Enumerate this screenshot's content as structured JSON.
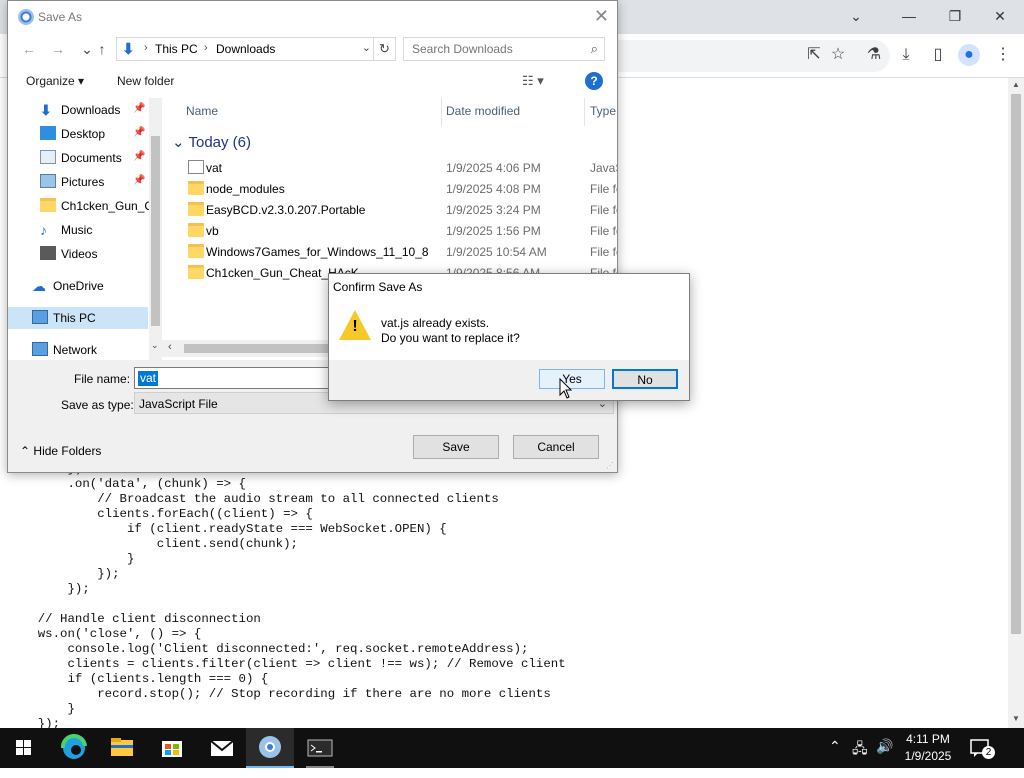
{
  "save_dialog": {
    "title": "Save As",
    "address": {
      "crumb1": "This PC",
      "crumb2": "Downloads"
    },
    "search_placeholder": "Search Downloads",
    "toolbar": {
      "organize": "Organize ▾",
      "new_folder": "New folder"
    },
    "nav": {
      "downloads": "Downloads",
      "desktop": "Desktop",
      "documents": "Documents",
      "pictures": "Pictures",
      "chicken": "Ch1cken_Gun_C",
      "music": "Music",
      "videos": "Videos",
      "onedrive": "OneDrive",
      "thispc": "This PC",
      "network": "Network"
    },
    "columns": {
      "name": "Name",
      "date": "Date modified",
      "type": "Type"
    },
    "group_label": "Today (6)",
    "files": {
      "f0": {
        "name": "vat",
        "date": "1/9/2025 4:06 PM",
        "type": "JavaS"
      },
      "f1": {
        "name": "node_modules",
        "date": "1/9/2025 4:08 PM",
        "type": "File fo"
      },
      "f2": {
        "name": "EasyBCD.v2.3.0.207.Portable",
        "date": "1/9/2025 3:24 PM",
        "type": "File fo"
      },
      "f3": {
        "name": "vb",
        "date": "1/9/2025 1:56 PM",
        "type": "File fo"
      },
      "f4": {
        "name": "Windows7Games_for_Windows_11_10_8",
        "date": "1/9/2025 10:54 AM",
        "type": "File fo"
      },
      "f5": {
        "name": "Ch1cken_Gun_Cheat_HAcK",
        "date": "1/9/2025 8:56 AM",
        "type": "File fo"
      }
    },
    "file_name_label": "File name:",
    "file_name_value": "vat",
    "save_type_label": "Save as type:",
    "save_type_value": "JavaScript File",
    "hide_folders": "Hide Folders",
    "save_button": "Save",
    "cancel_button": "Cancel"
  },
  "confirm_dialog": {
    "title": "Confirm Save As",
    "line1": "vat.js already exists.",
    "line2": "Do you want to replace it?",
    "yes": "Yes",
    "no": "No"
  },
  "code_text": "        })\n        .on('data', (chunk) => {\n            // Broadcast the audio stream to all connected clients\n            clients.forEach((client) => {\n                if (client.readyState === WebSocket.OPEN) {\n                    client.send(chunk);\n                }\n            });\n        });\n\n    // Handle client disconnection\n    ws.on('close', () => {\n        console.log('Client disconnected:', req.socket.remoteAddress);\n        clients = clients.filter(client => client !== ws); // Remove client\n        if (clients.length === 0) {\n            record.stop(); // Stop recording if there are no more clients\n        }\n    });",
  "taskbar": {
    "time": "4:11 PM",
    "date": "1/9/2025",
    "notification_count": "2"
  },
  "colors": {
    "accent": "#0078d7",
    "folder": "#ffd764",
    "warning": "#f7c928",
    "taskbar": "#101010"
  }
}
